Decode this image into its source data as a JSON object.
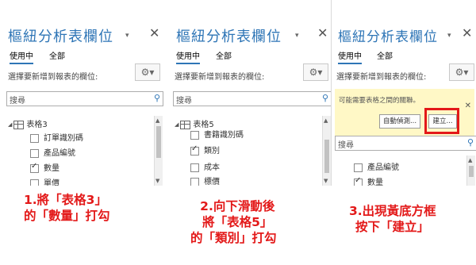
{
  "panes": [
    {
      "title": "樞紐分析表欄位",
      "tabs": [
        "使用中",
        "全部"
      ],
      "prompt": "選擇要新增到報表的欄位:",
      "search_placeholder": "搜尋",
      "table_name": "表格3",
      "fields": [
        {
          "label": "訂單識別碼",
          "checked": false
        },
        {
          "label": "產品編號",
          "checked": false
        },
        {
          "label": "數量",
          "checked": true
        },
        {
          "label": "單價",
          "checked": false
        }
      ]
    },
    {
      "title": "樞紐分析表欄位",
      "tabs": [
        "使用中",
        "全部"
      ],
      "prompt": "選擇要新增到報表的欄位:",
      "search_placeholder": "搜尋",
      "table_name": "表格5",
      "fields": [
        {
          "label": "書籍識別碼",
          "checked": false
        },
        {
          "label": "類別",
          "checked": true
        },
        {
          "label": "成本",
          "checked": false
        },
        {
          "label": "標價",
          "checked": false
        }
      ]
    },
    {
      "title": "樞紐分析表欄位",
      "tabs": [
        "使用中",
        "全部"
      ],
      "prompt": "選擇要新增到報表的欄位:",
      "notice_text": "可能需要表格之間的關聯。",
      "auto_detect_label": "自動偵測...",
      "create_label": "建立...",
      "search_placeholder": "搜尋",
      "fields": [
        {
          "label": "產品編號",
          "checked": false
        },
        {
          "label": "數量",
          "checked": true
        }
      ]
    }
  ],
  "captions": [
    [
      "1.將「表格3」",
      "的「數量」打勾"
    ],
    [
      "2.向下滑動後",
      "將「表格5」",
      "的「類別」打勾"
    ],
    [
      "3.出現黃底方框",
      "按下「建立」"
    ]
  ],
  "colors": {
    "accent": "#2e75b6",
    "caption": "#e31919",
    "notice_bg": "#fff8c6"
  }
}
